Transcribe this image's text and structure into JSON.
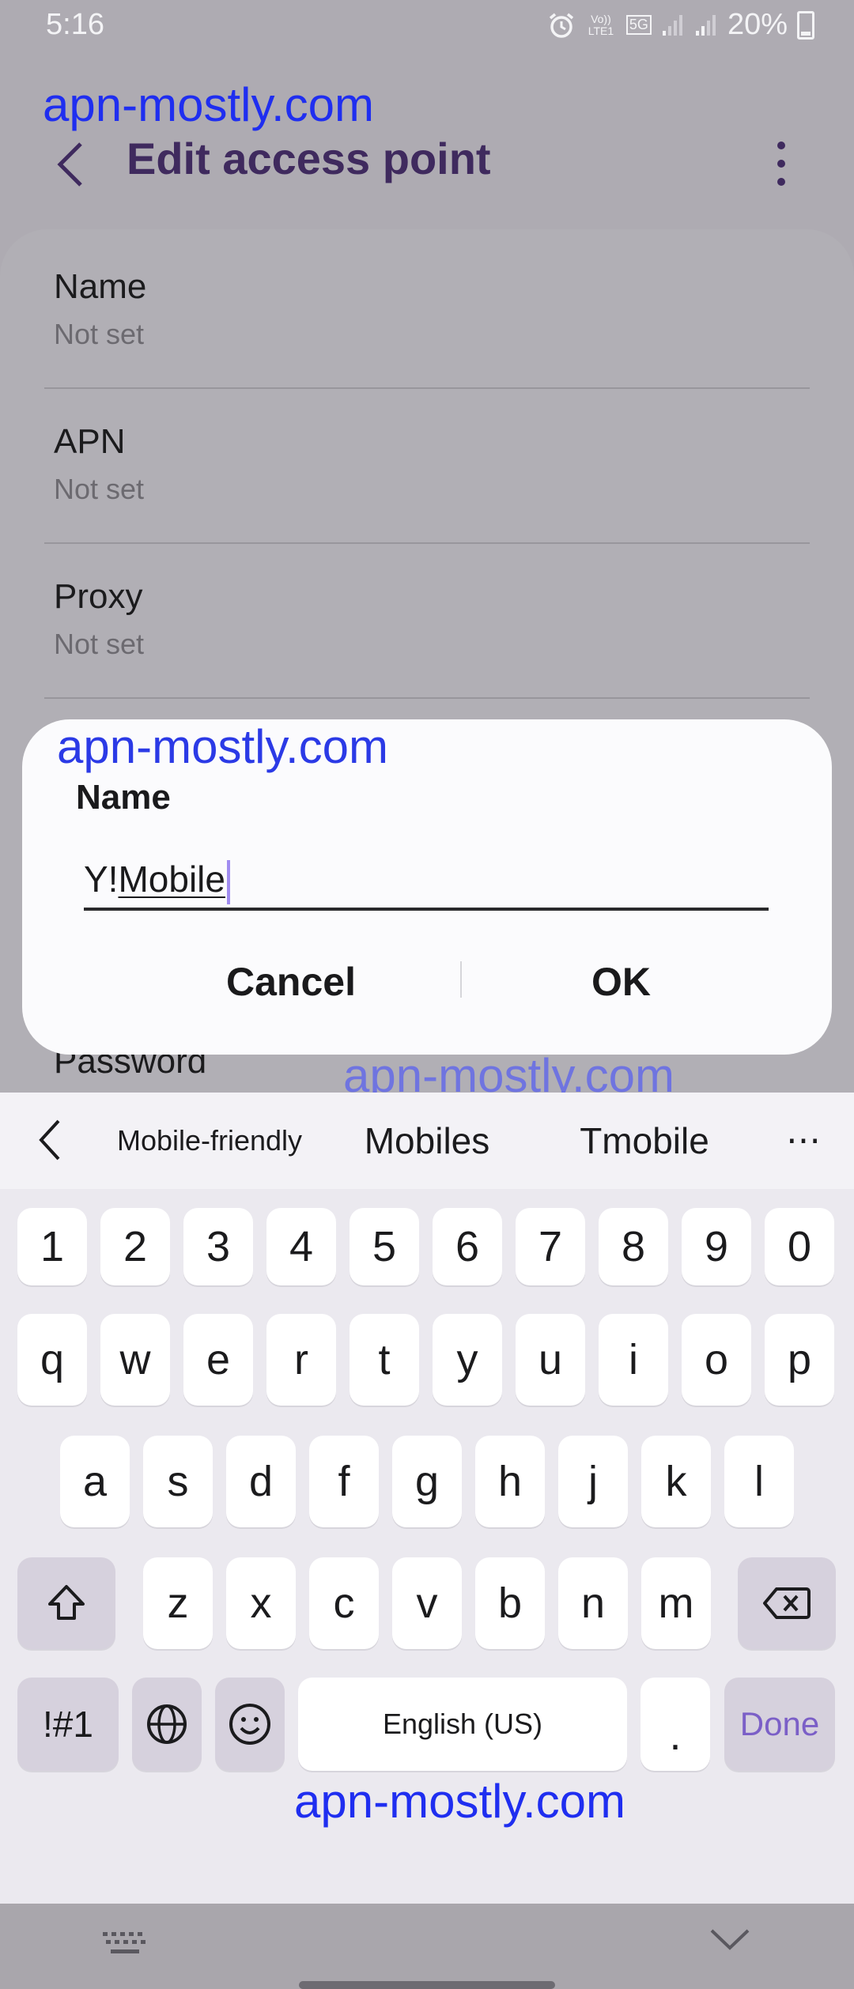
{
  "status_bar": {
    "time": "5:16",
    "volte": "Vo)) LTE1",
    "network": "5G",
    "battery": "20%"
  },
  "watermarks": [
    "apn-mostly.com",
    "apn-mostly.com",
    "apn-mostly.com",
    "apn-mostly.com"
  ],
  "app_bar": {
    "title": "Edit access point"
  },
  "fields": [
    {
      "label": "Name",
      "value": "Not set"
    },
    {
      "label": "APN",
      "value": "Not set"
    },
    {
      "label": "Proxy",
      "value": "Not set"
    },
    {
      "label": "Password"
    }
  ],
  "dialog": {
    "title": "Name",
    "input_value": "Y!Mobile",
    "input_prefix": "Y!",
    "input_word": "Mobile",
    "cancel": "Cancel",
    "ok": "OK"
  },
  "keyboard": {
    "suggestions": [
      "Mobile-friendly",
      "Mobiles",
      "Tmobile"
    ],
    "more": "⋯",
    "row_numbers": [
      "1",
      "2",
      "3",
      "4",
      "5",
      "6",
      "7",
      "8",
      "9",
      "0"
    ],
    "row_top": [
      "q",
      "w",
      "e",
      "r",
      "t",
      "y",
      "u",
      "i",
      "o",
      "p"
    ],
    "row_home": [
      "a",
      "s",
      "d",
      "f",
      "g",
      "h",
      "j",
      "k",
      "l"
    ],
    "row_bottom": [
      "z",
      "x",
      "c",
      "v",
      "b",
      "n",
      "m"
    ],
    "symbols": "!#1",
    "space": "English (US)",
    "period": ".",
    "done": "Done"
  },
  "colors": {
    "watermark": "#1f2ef0",
    "title": "#3f2a5e",
    "done": "#7b5fc7"
  }
}
